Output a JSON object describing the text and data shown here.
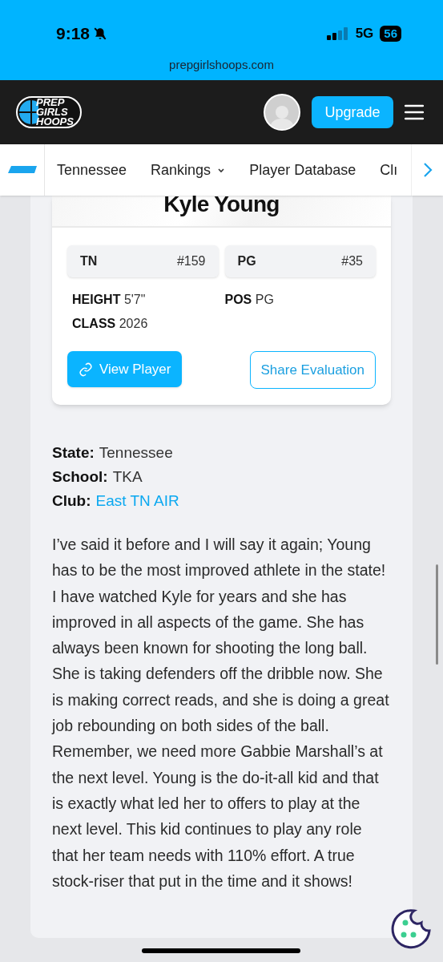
{
  "status_bar": {
    "time": "9:18",
    "network": "5G",
    "battery": "56"
  },
  "browser": {
    "url": "prepgirlshoops.com"
  },
  "header": {
    "logo": [
      "PREP",
      "GIRLS",
      "HOOPS"
    ],
    "upgrade_button": "Upgrade"
  },
  "nav": {
    "items": [
      {
        "label": "Tennessee",
        "dropdown": false
      },
      {
        "label": "Rankings",
        "dropdown": true
      },
      {
        "label": "Player Database",
        "dropdown": false
      },
      {
        "label": "Clı",
        "dropdown": false
      }
    ]
  },
  "player_card": {
    "name": "Kyle Young",
    "ranks": [
      {
        "label": "TN",
        "value": "#159"
      },
      {
        "label": "PG",
        "value": "#35"
      }
    ],
    "details": [
      {
        "label": "HEIGHT",
        "value": "5'7\""
      },
      {
        "label": "POS",
        "value": "PG"
      },
      {
        "label": "CLASS",
        "value": "2026"
      }
    ],
    "view_button": "View Player",
    "share_button": "Share Evaluation"
  },
  "info": [
    {
      "label": "State:",
      "value": "Tennessee",
      "kind": "text"
    },
    {
      "label": "School:",
      "value": "TKA",
      "kind": "text"
    },
    {
      "label": "Club:",
      "value": "East TN AIR",
      "kind": "link"
    }
  ],
  "evaluation": "I’ve said it before and I will say it again; Young has to be the most improved athlete in the state! I have watched Kyle for years and she has improved in all aspects of the game. She has always been known for shooting the long ball. She is taking defenders off the dribble now. She is making correct reads, and she is doing a great job rebounding on both sides of the ball. Remember, we need more Gabbie Marshall’s at the next level. Young is the do-it-all kid and that is exactly what led her to offers to play at the next level. This kid continues to play any role that her team needs with 110% effort. A true stock-riser that put in the time and it shows!"
}
